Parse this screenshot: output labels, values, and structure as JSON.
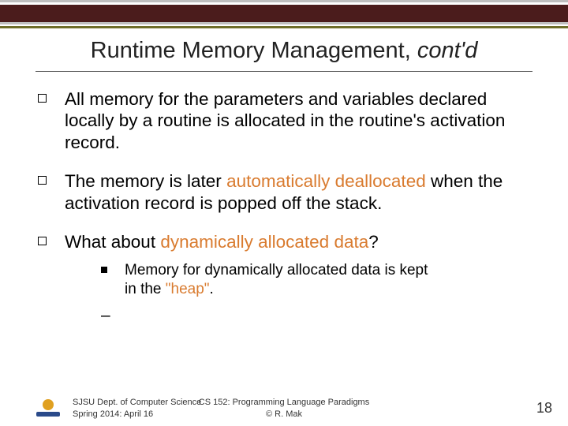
{
  "title_main": "Runtime Memory Management, ",
  "title_italic": "cont'd",
  "bullets": [
    {
      "pre": "All memory for the parameters and variables declared locally by a routine is allocated in the routine's activation record."
    },
    {
      "pre": "The memory is later ",
      "orange": "automatically deallocated",
      "post": " when the activation record is popped off the stack."
    },
    {
      "pre": "What about ",
      "orange": "dynamically allocated data",
      "post": "?"
    }
  ],
  "sub": {
    "line_pre": "Memory for dynamically allocated data is kept in the ",
    "line_orange": "\"heap\"",
    "line_post": "."
  },
  "footer": {
    "left1": "SJSU Dept. of Computer Science",
    "left2": "Spring 2014: April 16",
    "center1": "CS 152: Programming Language Paradigms",
    "center2": "© R. Mak",
    "page": "18"
  }
}
